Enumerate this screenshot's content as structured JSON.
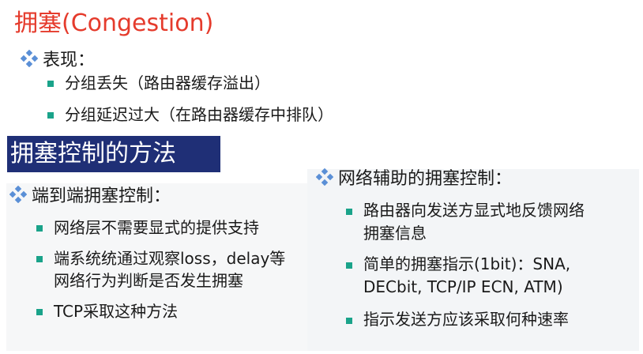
{
  "title": "拥塞(Congestion)",
  "manifest": {
    "heading": "表现：",
    "items": [
      "分组丢失（路由器缓存溢出）",
      "分组延迟过大（在路由器缓存中排队）"
    ]
  },
  "banner": "拥塞控制的方法",
  "end_to_end": {
    "heading": "端到端拥塞控制：",
    "item1": "网络层不需要显式的提供支持",
    "item2_line1": "端系统统通过观察loss，delay等",
    "item2_line2": "网络行为判断是否发生拥塞",
    "item3": "TCP采取这种方法"
  },
  "network_assisted": {
    "heading": "网络辅助的拥塞控制：",
    "item1_line1": "路由器向发送方显式地反馈网络",
    "item1_line2": "拥塞信息",
    "item2_line1": "简单的拥塞指示(1bit)：SNA,",
    "item2_line2": "DECbit, TCP/IP ECN, ATM)",
    "item3": "指示发送方应该采取何种速率"
  },
  "colors": {
    "title": "#e53b2c",
    "banner_bg": "#1f2f76",
    "bullet_square": "#1aa38a",
    "diamond": "#5a8fd6"
  }
}
